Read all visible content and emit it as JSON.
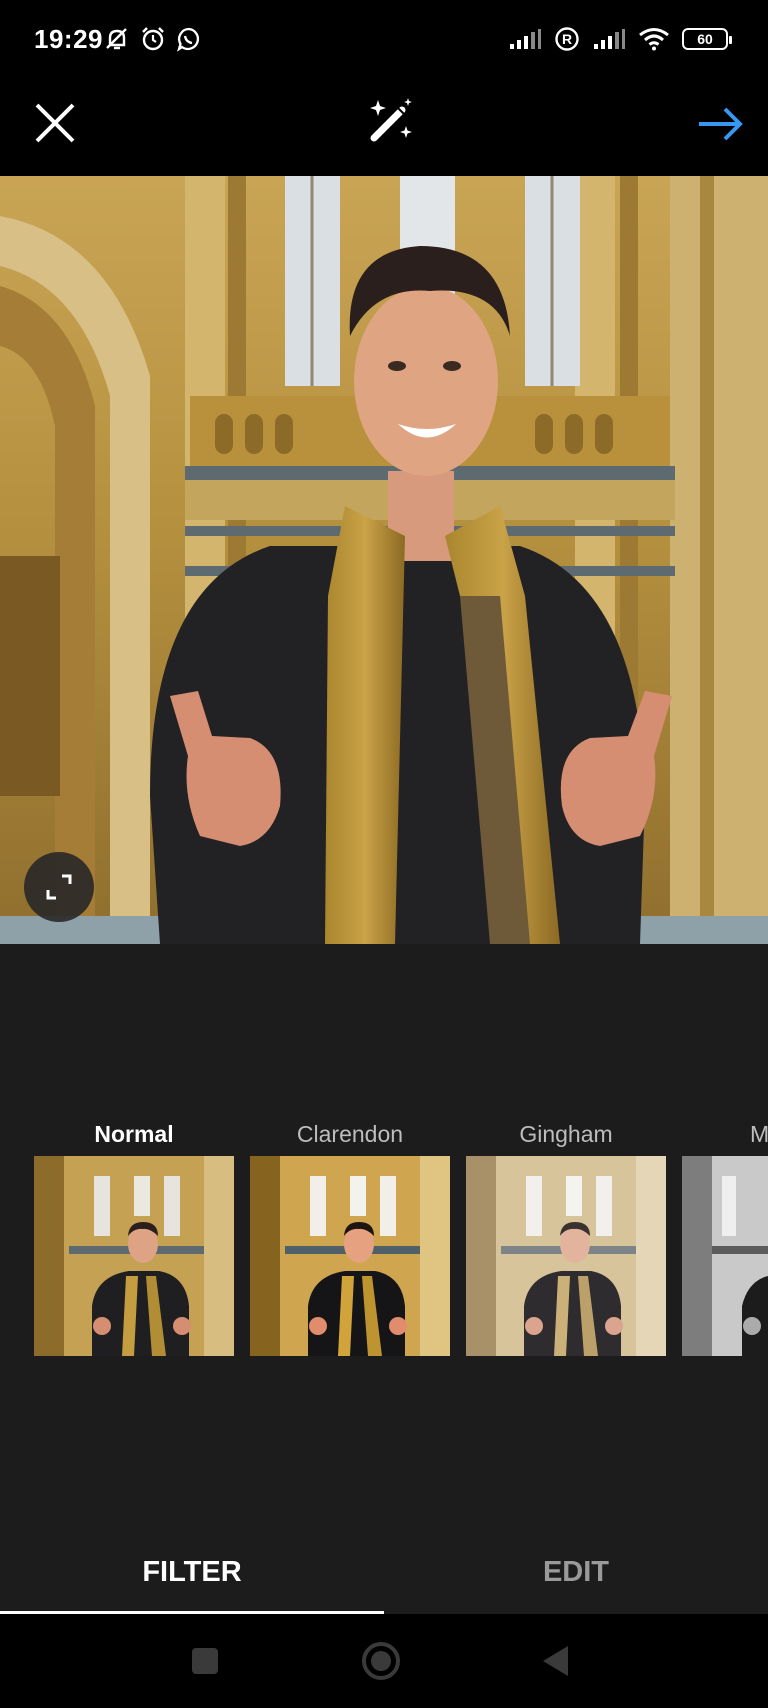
{
  "status_bar": {
    "time": "19:29",
    "battery": "60",
    "icons": [
      "mute-bell-icon",
      "alarm-icon",
      "whatsapp-icon",
      "signal-icon",
      "roaming-r-icon",
      "signal-icon",
      "wifi-icon",
      "battery-icon"
    ]
  },
  "toolbar": {
    "close_icon": "close-icon",
    "magic_icon": "magic-wand-icon",
    "next_icon": "arrow-right-icon",
    "accent": "#3897f0"
  },
  "photo": {
    "expand_icon": "expand-icon"
  },
  "filters": [
    {
      "label": "Normal",
      "active": true
    },
    {
      "label": "Clarendon",
      "active": false
    },
    {
      "label": "Gingham",
      "active": false
    },
    {
      "label": "M",
      "active": false
    }
  ],
  "tabs": {
    "filter": "FILTER",
    "edit": "EDIT",
    "selected": "FILTER"
  },
  "nav_bar": {
    "icons": [
      "recents-square-icon",
      "home-circle-icon",
      "back-triangle-icon"
    ]
  }
}
